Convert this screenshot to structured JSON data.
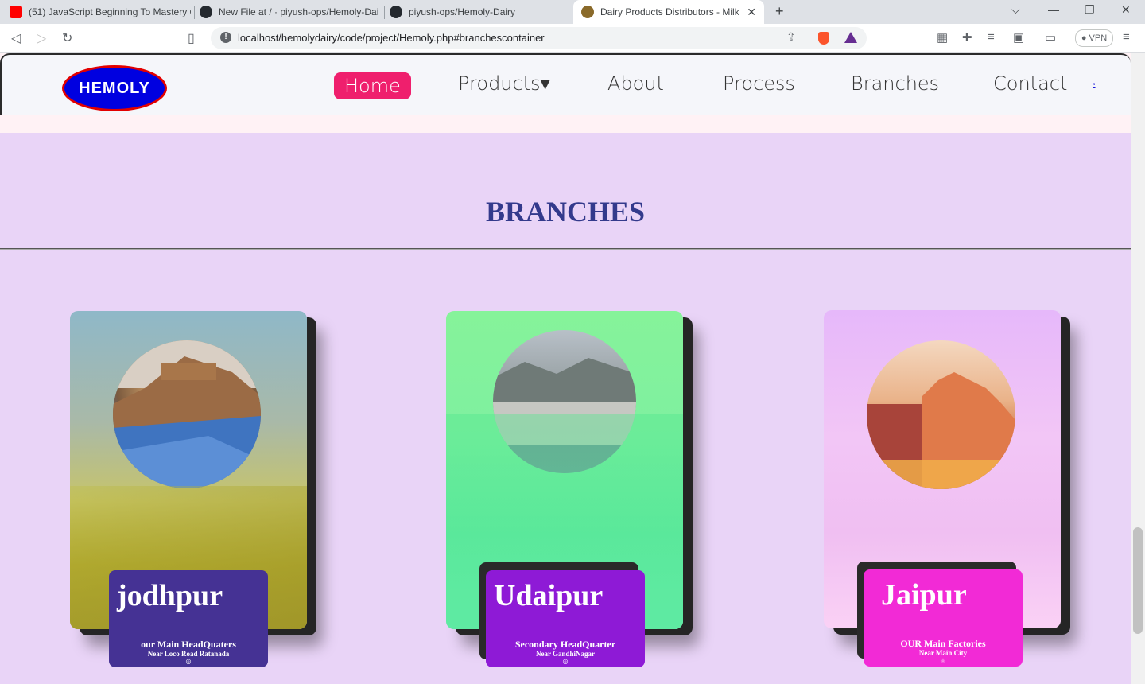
{
  "browser": {
    "tabs": [
      {
        "title": "(51) JavaScript Beginning To Mastery C",
        "icon": "youtube-icon"
      },
      {
        "title": "New File at / · piyush-ops/Hemoly-Dai",
        "icon": "github-icon"
      },
      {
        "title": "piyush-ops/Hemoly-Dairy",
        "icon": "github-icon"
      },
      {
        "title": "Dairy Products Distributors - Milk",
        "icon": "site-favicon",
        "active": true
      }
    ],
    "url": "localhost/hemolydairy/code/project/Hemoly.php#branchescontainer",
    "vpn_label": "VPN"
  },
  "site": {
    "logo": "HEMOLY",
    "nav": [
      {
        "label": "Home",
        "active": true
      },
      {
        "label": "Products▾"
      },
      {
        "label": "About"
      },
      {
        "label": "Process"
      },
      {
        "label": "Branches"
      },
      {
        "label": "Contact"
      }
    ],
    "user_link": "▫"
  },
  "section": {
    "title": "BRANCHES"
  },
  "branches": [
    {
      "city": "jodhpur",
      "line1": "our Main HeadQuaters",
      "line2": "Near Loco Road Ratanada",
      "pin": "◎",
      "label_color": "#453294"
    },
    {
      "city": "Udaipur",
      "line1": "Secondary HeadQuarter",
      "line2": "Near GandhiNagar",
      "pin": "◎",
      "label_color": "#8e1ad6"
    },
    {
      "city": "Jaipur",
      "line1": "OUR Main Factories",
      "line2": "Near Main City",
      "pin": "◎",
      "label_color": "#f22ad6"
    }
  ]
}
